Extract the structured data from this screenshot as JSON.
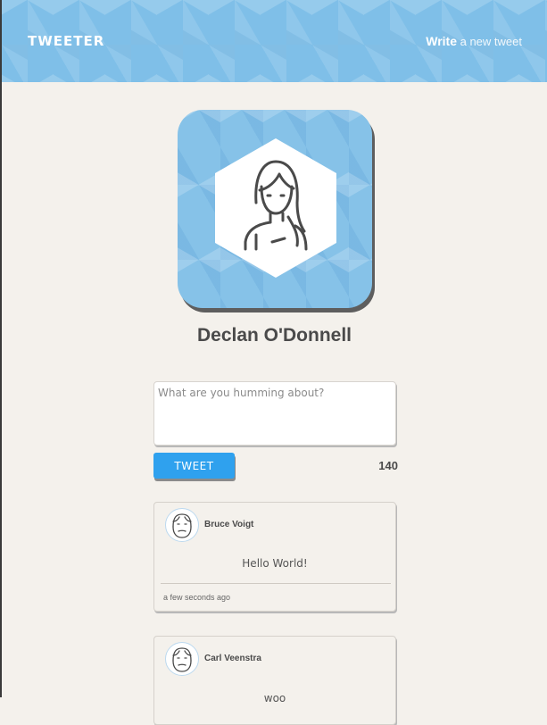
{
  "header": {
    "brand": "TWEETER",
    "write_bold": "Write",
    "write_rest": " a new tweet"
  },
  "profile": {
    "name": "Declan O'Donnell",
    "avatar_icon": "woman-portrait-icon"
  },
  "composer": {
    "placeholder": "What are you humming about?",
    "value": "",
    "button_label": "TWEET",
    "remaining_chars": "140"
  },
  "tweets": [
    {
      "author": "Bruce Voigt",
      "text": "Hello World!",
      "timestamp": "a few seconds ago",
      "avatar_icon": "bearded-man-icon"
    },
    {
      "author": "Carl Veenstra",
      "text": "woo",
      "timestamp": "",
      "avatar_icon": "bearded-man-icon"
    }
  ],
  "colors": {
    "accent_blue": "#2fa1ee",
    "header_blue": "#7fbfe8",
    "background": "#f4f1ec",
    "text_dark": "#4a4a4a"
  }
}
